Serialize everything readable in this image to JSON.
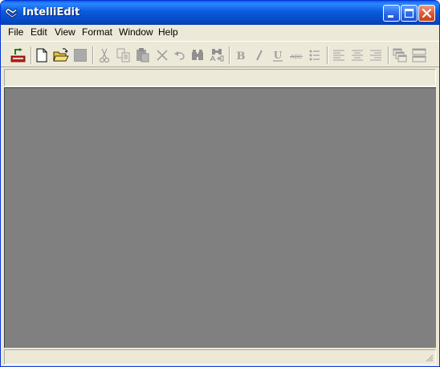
{
  "window": {
    "title": "IntelliEdit"
  },
  "menu": {
    "items": [
      {
        "label": "File"
      },
      {
        "label": "Edit"
      },
      {
        "label": "View"
      },
      {
        "label": "Format"
      },
      {
        "label": "Window"
      },
      {
        "label": "Help"
      }
    ]
  },
  "toolbar": {
    "buttons": [
      {
        "icon": "exit-app-icon",
        "enabled": true
      },
      {
        "icon": "new-document-icon",
        "enabled": true
      },
      {
        "icon": "open-folder-icon",
        "enabled": true
      },
      {
        "icon": "save-icon",
        "enabled": false
      },
      {
        "icon": "cut-icon",
        "enabled": false
      },
      {
        "icon": "copy-icon",
        "enabled": false
      },
      {
        "icon": "paste-icon",
        "enabled": false
      },
      {
        "icon": "delete-icon",
        "enabled": false
      },
      {
        "icon": "undo-icon",
        "enabled": false
      },
      {
        "icon": "find-icon",
        "enabled": false
      },
      {
        "icon": "replace-icon",
        "enabled": false
      },
      {
        "icon": "bold-icon",
        "enabled": false
      },
      {
        "icon": "italic-icon",
        "enabled": false
      },
      {
        "icon": "underline-icon",
        "enabled": false
      },
      {
        "icon": "strikethrough-icon",
        "enabled": false
      },
      {
        "icon": "bullet-list-icon",
        "enabled": false
      },
      {
        "icon": "align-left-icon",
        "enabled": false
      },
      {
        "icon": "align-center-icon",
        "enabled": false
      },
      {
        "icon": "align-right-icon",
        "enabled": false
      },
      {
        "icon": "cascade-windows-icon",
        "enabled": false
      },
      {
        "icon": "tile-windows-icon",
        "enabled": false
      }
    ]
  },
  "colors": {
    "titlebar": "#0a5bdc",
    "face": "#ece9d8",
    "workspace": "#808080",
    "disabled_icon": "#a0a0a0"
  }
}
